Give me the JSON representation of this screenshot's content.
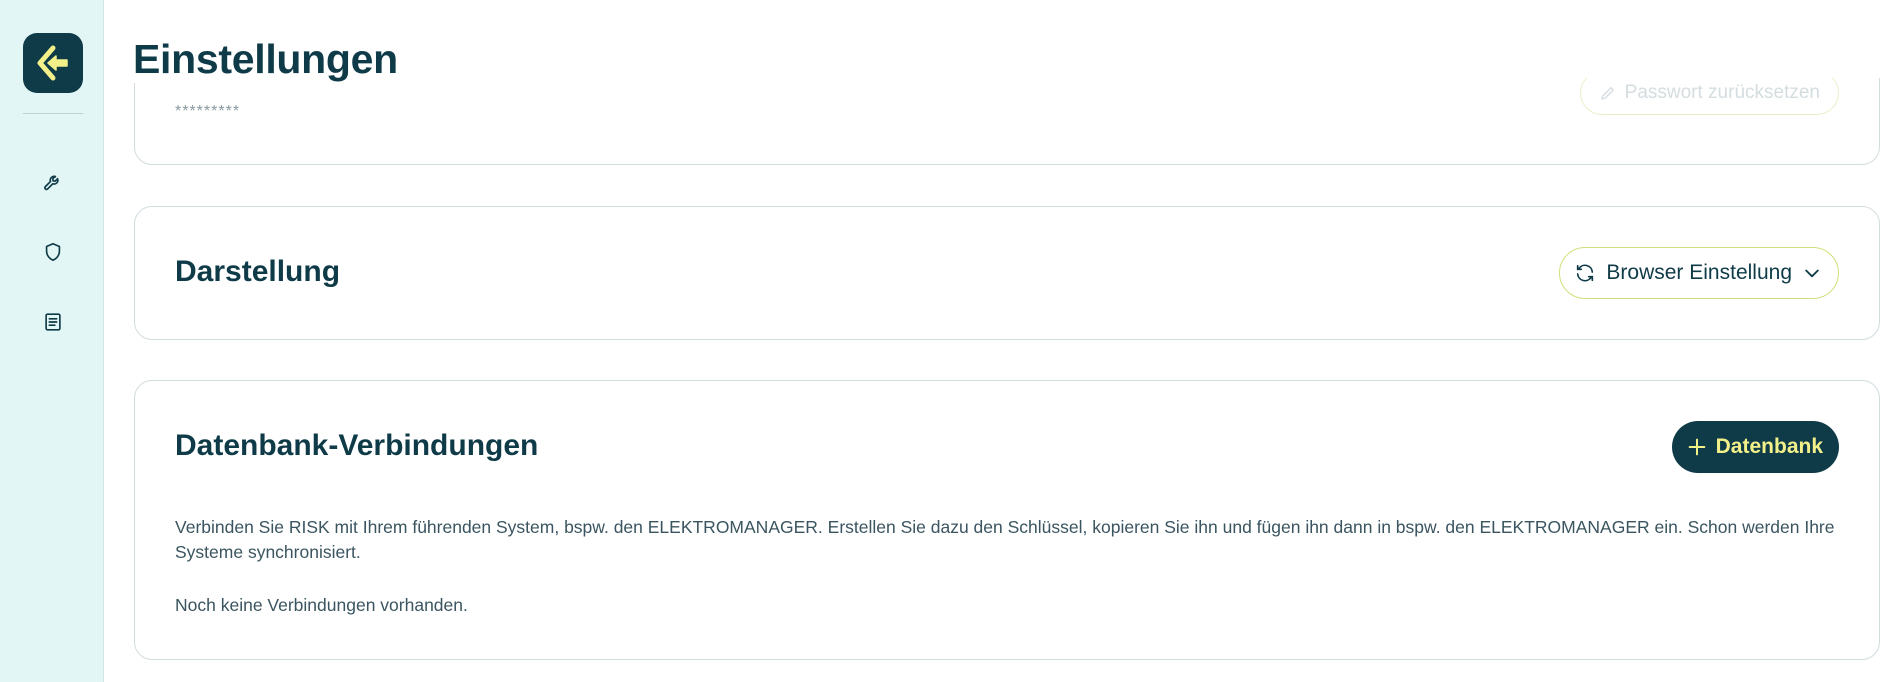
{
  "sidebar": {
    "logo_icon": "brand-logo-icon",
    "items": [
      {
        "icon": "wrench-icon"
      },
      {
        "icon": "shield-icon"
      },
      {
        "icon": "document-list-icon"
      }
    ]
  },
  "header": {
    "title": "Einstellungen"
  },
  "password_card": {
    "masked_value": "*********",
    "reset_label": "Passwort zurücksetzen"
  },
  "display_card": {
    "title": "Darstellung",
    "theme_select_label": "Browser Einstellung",
    "theme_icon": "refresh-icon",
    "chevron_icon": "chevron-down-icon"
  },
  "db_card": {
    "title": "Datenbank-Verbindungen",
    "add_button_label": "Datenbank",
    "add_icon": "plus-icon",
    "description": "Verbinden Sie RISK mit Ihrem führenden System, bspw. den ELEKTROMANAGER. Erstellen Sie dazu den Schlüssel, kopieren Sie ihn und fügen ihn dann in bspw. den ELEKTROMANAGER ein. Schon werden Ihre Systeme synchronisiert.",
    "empty_text": "Noch keine Verbindungen vorhanden."
  },
  "colors": {
    "primary": "#0f3b48",
    "accent": "#f3f08a",
    "sidebar_bg": "#e2f6f6",
    "outline_accent": "#cfe07a"
  }
}
